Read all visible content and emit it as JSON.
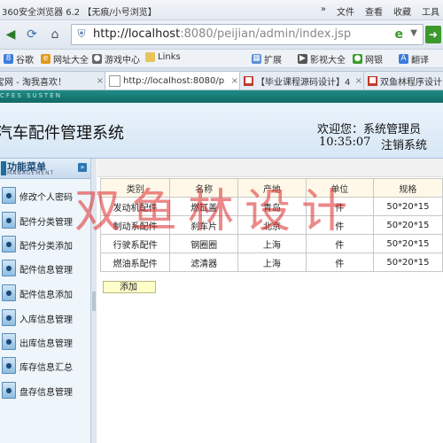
{
  "browser": {
    "window_title": "360安全浏览器 6.2 【无痕/小号浏览】",
    "menus": [
      "»",
      "文件",
      "查看",
      "收藏",
      "工具"
    ],
    "url_host": "http://localhost",
    "url_rest": ":8080/peijian/admin/index.jsp",
    "bookmarks": [
      "谷歌",
      "网址大全",
      "游戏中心",
      "Links",
      "扩展",
      "影视大全",
      "网银",
      "翻译"
    ],
    "tabs": [
      {
        "label": "淘宝网 - 淘我喜欢！"
      },
      {
        "label": "http://localhost:8080/p"
      },
      {
        "label": "【毕业课程源码设计】4"
      },
      {
        "label": "双鱼林程序设计"
      }
    ]
  },
  "app": {
    "strip_sub": "CFES SUSTEN",
    "title": "汽车配件管理系统",
    "welcome": "欢迎您：系统管理员",
    "time": "10:35:07",
    "logout": "注销系统"
  },
  "sidebar": {
    "title": "功能菜单",
    "subtitle": "MANAGEMENT",
    "items": [
      {
        "label": "修改个人密码"
      },
      {
        "label": "配件分类管理"
      },
      {
        "label": "配件分类添加"
      },
      {
        "label": "配件信息管理"
      },
      {
        "label": "配件信息添加"
      },
      {
        "label": "入库信息管理"
      },
      {
        "label": "出库信息管理"
      },
      {
        "label": "库存信息汇总"
      },
      {
        "label": "盘存信息管理"
      }
    ]
  },
  "table": {
    "headers": [
      "类别",
      "名称",
      "产地",
      "单位",
      "规格"
    ],
    "rows": [
      [
        "发动机配件",
        "燃缸盖",
        "青岛",
        "件",
        "50*20*15"
      ],
      [
        "制动系配件",
        "刹车片",
        "北京",
        "件",
        "50*20*15"
      ],
      [
        "行驶系配件",
        "钢圈圈",
        "上海",
        "件",
        "50*20*15"
      ],
      [
        "燃油系配件",
        "滤清器",
        "上海",
        "件",
        "50*20*15"
      ]
    ]
  },
  "add_label": "添加",
  "watermark": "双鱼林设计"
}
